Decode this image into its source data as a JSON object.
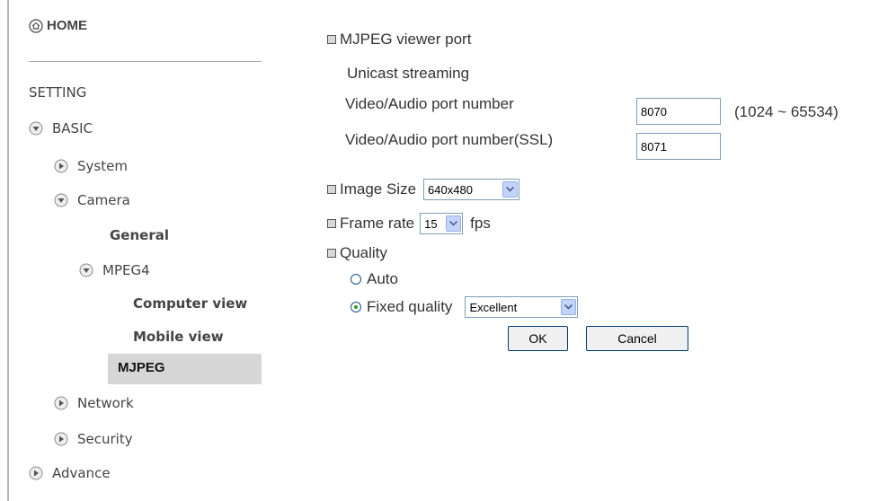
{
  "sidebar": {
    "home": "HOME",
    "setting": "SETTING",
    "basic": "BASIC",
    "system": "System",
    "camera": "Camera",
    "general": "General",
    "mpeg4": "MPEG4",
    "computer_view": "Computer view",
    "mobile_view": "Mobile view",
    "mjpeg": "MJPEG",
    "network": "Network",
    "security": "Security",
    "advance": "Advance"
  },
  "main": {
    "mjpeg_viewer_port": "MJPEG viewer port",
    "unicast_streaming": "Unicast streaming",
    "port_label": "Video/Audio port number",
    "port_value": "8070",
    "port_range": "(1024 ~ 65534)",
    "ssl_port_label": "Video/Audio port number(SSL)",
    "ssl_port_value": "8071",
    "image_size_label": "Image Size",
    "image_size_value": "640x480",
    "frame_rate_label": "Frame rate",
    "frame_rate_value": "15",
    "fps_label": "fps",
    "quality_label": "Quality",
    "auto_label": "Auto",
    "fixed_quality_label": "Fixed quality",
    "fixed_quality_value": "Excellent",
    "quality_mode": "Fixed quality",
    "ok_button": "OK",
    "cancel_button": "Cancel"
  },
  "colors": {
    "active_bg": "#d6d6d6",
    "divider": "#b7b7b7",
    "input_border": "#7f9db9"
  }
}
